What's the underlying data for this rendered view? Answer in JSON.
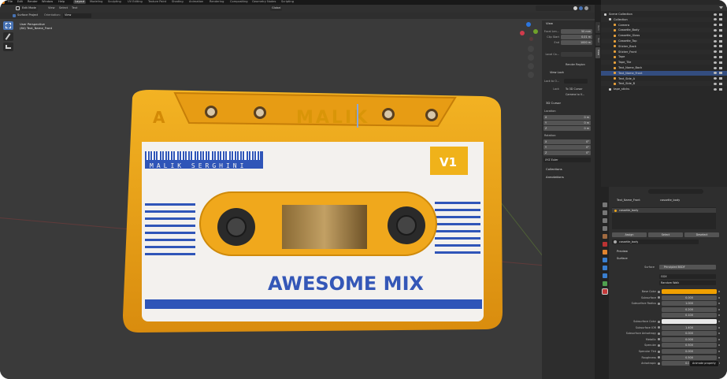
{
  "topmenu": {
    "items": [
      "File",
      "Edit",
      "Render",
      "Window",
      "Help"
    ],
    "workspaces": [
      "Layout",
      "Modeling",
      "Sculpting",
      "UV Editing",
      "Texture Paint",
      "Shading",
      "Animation",
      "Rendering",
      "Compositing",
      "Geometry Nodes",
      "Scripting"
    ],
    "active_workspace": "Layout",
    "scene_label": "Scene",
    "viewlayer_label": "ViewLayer"
  },
  "viewport_header": {
    "mode": "Edit Mode",
    "view": "View",
    "select": "Select",
    "text": "Text",
    "snap_global": "Global",
    "surface_project": "Surface Project",
    "orientation_label": "Orientation:",
    "orientation_value": "View"
  },
  "viewport_overlay": {
    "perspective": "User Perspective",
    "object": "(84) Text_Name_Front"
  },
  "cassette": {
    "side_letter": "A",
    "brand": "MALIK",
    "owner": "MALIK SERGHINI",
    "version": "V1",
    "title": "AWESOME MIX",
    "colors": {
      "shell": "#f0a81c",
      "label": "#f3f1ee",
      "stripe": "#2f55b8",
      "title": "#3457b7",
      "window": "#7a5a2a"
    }
  },
  "npanel": {
    "view_header": "View",
    "focal_label": "Focal Len...",
    "focal_value": "50 mm",
    "clip_start_label": "Clip Start",
    "clip_start_value": "0.01 m",
    "clip_end_label": "End",
    "clip_end_value": "1000 m",
    "local_cam_label": "Local Ca...",
    "render_region": "Render Region",
    "view_lock": "View Lock",
    "lock_to_obj_label": "Lock to O...",
    "lock_label": "Lock",
    "to_3d_cursor": "To 3D Cursor",
    "camera_to_view": "Camera to V...",
    "cursor_header": "3D Cursor",
    "location_label": "Location:",
    "loc": [
      {
        "axis": "X",
        "value": "0 m"
      },
      {
        "axis": "Y",
        "value": "0 m"
      },
      {
        "axis": "Z",
        "value": "0 m"
      }
    ],
    "rotation_label": "Rotation:",
    "rot": [
      {
        "axis": "X",
        "value": "0°"
      },
      {
        "axis": "Y",
        "value": "0°"
      },
      {
        "axis": "Z",
        "value": "0°"
      }
    ],
    "rot_mode": "XYZ Euler",
    "collections": "Collections",
    "annotations": "Annotations",
    "tabs": [
      "Item",
      "Tool",
      "View"
    ]
  },
  "outliner": {
    "rows": [
      {
        "label": "Scene Collection",
        "indent": 0
      },
      {
        "label": "Collection",
        "indent": 1
      },
      {
        "label": "Camera",
        "indent": 2
      },
      {
        "label": "Cassette_Body",
        "indent": 2
      },
      {
        "label": "Cassette_Glass",
        "indent": 2
      },
      {
        "label": "Cassette_Top",
        "indent": 2
      },
      {
        "label": "Sticker_Back",
        "indent": 2
      },
      {
        "label": "Sticker_Front",
        "indent": 2
      },
      {
        "label": "Tape",
        "indent": 2
      },
      {
        "label": "Tape_Tile",
        "indent": 2
      },
      {
        "label": "Text_Name_Back",
        "indent": 2
      },
      {
        "label": "Text_Name_Front",
        "indent": 2
      },
      {
        "label": "Text_Side_A",
        "indent": 2
      },
      {
        "label": "Text_Side_B",
        "indent": 2
      },
      {
        "label": "tape_sticks",
        "indent": 1
      }
    ],
    "selected_index": 11
  },
  "properties": {
    "breadcrumb_object": "Text_Name_Front",
    "breadcrumb_material": "cassette_body",
    "slot_name": "cassette_body",
    "assign": "Assign",
    "select": "Select",
    "deselect": "Deselect",
    "material_name": "cassette_body",
    "preview_header": "Preview",
    "surface_header": "Surface",
    "surface_label": "Surface",
    "surface_value": "Principled BSDF",
    "distribution": "GGX",
    "subsurface_method": "Random Walk",
    "fields": [
      {
        "label": "Base Color",
        "value": "",
        "type": "color",
        "color": "#f0a000"
      },
      {
        "label": "Subsurface",
        "value": "0.000"
      },
      {
        "label": "Subsurface Radius",
        "value": "1.000"
      },
      {
        "label": "",
        "value": "0.200"
      },
      {
        "label": "",
        "value": "0.100"
      },
      {
        "label": "Subsurface Color",
        "value": "",
        "type": "color",
        "color": "#e8e8e8"
      },
      {
        "label": "Subsurface IOR",
        "value": "1.400"
      },
      {
        "label": "Subsurface Anisotropy",
        "value": "0.000"
      },
      {
        "label": "Metallic",
        "value": "0.000"
      },
      {
        "label": "Specular",
        "value": "0.500"
      },
      {
        "label": "Specular Tint",
        "value": "0.000"
      },
      {
        "label": "Roughness",
        "value": "0.500"
      },
      {
        "label": "Anisotropic",
        "value": "0.000"
      }
    ],
    "tooltip": "Animate property"
  }
}
